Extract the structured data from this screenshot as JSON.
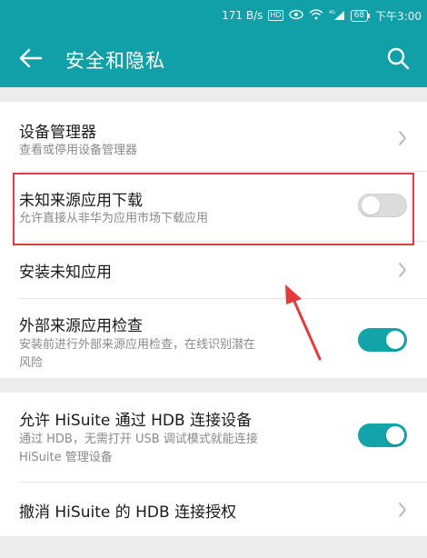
{
  "status_bar": {
    "network_speed": "171 B/s",
    "hd_badge": "HD",
    "signal_badge": "4G",
    "battery": "68",
    "time": "下午3:00"
  },
  "header": {
    "title": "安全和隐私",
    "icons": [
      "back-arrow-icon",
      "search-icon"
    ]
  },
  "colors": {
    "accent": "#12a0a8",
    "annotation": "#e23c3c"
  },
  "settings": {
    "device_manager": {
      "title": "设备管理器",
      "subtitle": "查看或停用设备管理器"
    },
    "unknown_sources": {
      "title": "未知来源应用下载",
      "subtitle": "允许直接从非华为应用市场下载应用",
      "enabled": false
    },
    "install_unknown": {
      "title": "安装未知应用"
    },
    "external_check": {
      "title": "外部来源应用检查",
      "subtitle_line1": "安装前进行外部来源应用检查，在线识别潜在",
      "subtitle_line2": "风险",
      "enabled": true
    },
    "hisuite_hdb": {
      "title": "允许 HiSuite 通过 HDB 连接设备",
      "subtitle_line1": "通过 HDB，无需打开 USB 调试模式就能连接",
      "subtitle_line2": "HiSuite 管理设备",
      "enabled": true
    },
    "revoke_hdb": {
      "title": "撤消 HiSuite 的 HDB 连接授权"
    }
  }
}
